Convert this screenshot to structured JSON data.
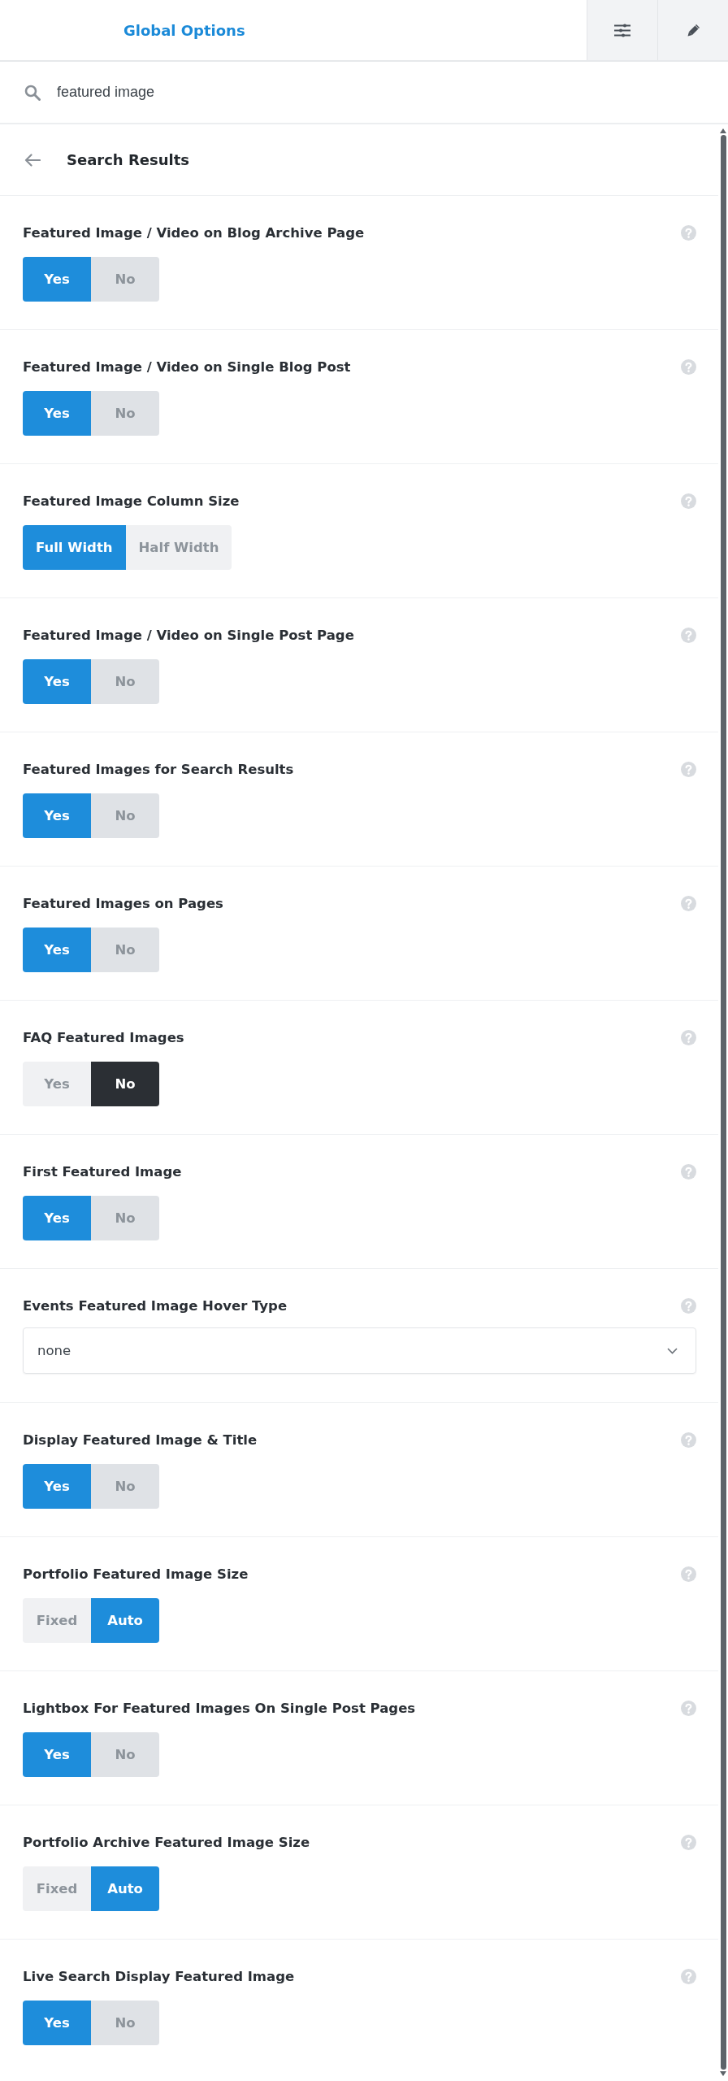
{
  "header": {
    "title": "Global Options"
  },
  "search": {
    "value": "featured image"
  },
  "results": {
    "title": "Search Results"
  },
  "options": [
    {
      "label": "Featured Image / Video on Blog Archive Page",
      "kind": "switch",
      "choices": [
        {
          "label": "Yes",
          "selected": true
        },
        {
          "label": "No",
          "selected": false
        }
      ]
    },
    {
      "label": "Featured Image / Video on Single Blog Post",
      "kind": "switch",
      "choices": [
        {
          "label": "Yes",
          "selected": true
        },
        {
          "label": "No",
          "selected": false
        }
      ]
    },
    {
      "label": "Featured Image Column Size",
      "kind": "buttonset",
      "choices": [
        {
          "label": "Full Width",
          "selected": true
        },
        {
          "label": "Half Width",
          "selected": false
        }
      ]
    },
    {
      "label": "Featured Image / Video on Single Post Page",
      "kind": "switch",
      "choices": [
        {
          "label": "Yes",
          "selected": true
        },
        {
          "label": "No",
          "selected": false
        }
      ]
    },
    {
      "label": "Featured Images for Search Results",
      "kind": "switch",
      "choices": [
        {
          "label": "Yes",
          "selected": true
        },
        {
          "label": "No",
          "selected": false
        }
      ]
    },
    {
      "label": "Featured Images on Pages",
      "kind": "switch",
      "choices": [
        {
          "label": "Yes",
          "selected": true
        },
        {
          "label": "No",
          "selected": false
        }
      ]
    },
    {
      "label": "FAQ Featured Images",
      "kind": "switch",
      "choices": [
        {
          "label": "Yes",
          "selected": false
        },
        {
          "label": "No",
          "selected": true
        }
      ]
    },
    {
      "label": "First Featured Image",
      "kind": "switch",
      "choices": [
        {
          "label": "Yes",
          "selected": true
        },
        {
          "label": "No",
          "selected": false
        }
      ]
    },
    {
      "label": "Events Featured Image Hover Type",
      "kind": "select",
      "value": "none"
    },
    {
      "label": "Display Featured Image & Title",
      "kind": "switch",
      "choices": [
        {
          "label": "Yes",
          "selected": true
        },
        {
          "label": "No",
          "selected": false
        }
      ]
    },
    {
      "label": "Portfolio Featured Image Size",
      "kind": "buttonset",
      "choices": [
        {
          "label": "Fixed",
          "selected": false
        },
        {
          "label": "Auto",
          "selected": true
        }
      ]
    },
    {
      "label": "Lightbox For Featured Images On Single Post Pages",
      "kind": "switch",
      "choices": [
        {
          "label": "Yes",
          "selected": true
        },
        {
          "label": "No",
          "selected": false
        }
      ]
    },
    {
      "label": "Portfolio Archive Featured Image Size",
      "kind": "buttonset",
      "choices": [
        {
          "label": "Fixed",
          "selected": false
        },
        {
          "label": "Auto",
          "selected": true
        }
      ]
    },
    {
      "label": "Live Search Display Featured Image",
      "kind": "switch",
      "choices": [
        {
          "label": "Yes",
          "selected": true
        },
        {
          "label": "No",
          "selected": false
        }
      ]
    }
  ]
}
